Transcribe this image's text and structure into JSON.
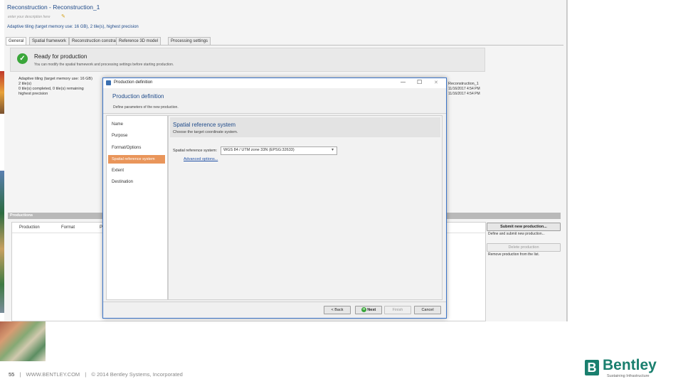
{
  "app": {
    "title": "Reconstruction - Reconstruction_1",
    "description_placeholder": "enter your description here",
    "summary": "Adaptive tiling (target memory use: 16 GB), 2 tile(s), highest precision",
    "tabs": [
      "General",
      "Spatial framework",
      "Reconstruction constraints",
      "Reference 3D model",
      "Processing settings"
    ],
    "status_title": "Ready for production",
    "status_sub": "You can modify the spatial framework and processing settings before starting production.",
    "info_lines": [
      "Adaptive tiling (target memory use: 16 GB)",
      "2 tile(s)",
      "0 tile(s) completed, 0 tile(s) remaining",
      "highest precision"
    ],
    "right_info_lines": [
      "Reconstruction_1",
      "11/16/2017 4:54 PM",
      "11/16/2017 4:54 PM"
    ],
    "productions_header": "Productions",
    "productions_columns": [
      "Production",
      "Format",
      "P"
    ],
    "submit_button": "Submit new production...",
    "submit_desc": "Define and submit new production...",
    "delete_button": "Delete production",
    "delete_desc": "Remove production from the list."
  },
  "dialog": {
    "window_title": "Production definition",
    "heading": "Production definition",
    "subheading": "Define parameters of the new production.",
    "controls": {
      "minimize": "—",
      "maximize": "☐",
      "close": "✕"
    },
    "nav": [
      "Name",
      "Purpose",
      "Format/Options",
      "Spatial reference system",
      "Extent",
      "Destination"
    ],
    "active_nav": "Spatial reference system",
    "section_title": "Spatial reference system",
    "section_sub": "Choose the target coordinate system.",
    "srs_label": "Spatial reference system:",
    "srs_value": "WGS 84 / UTM zone 33N (EPSG:32633)",
    "advanced_link": "Advanced options...",
    "buttons": {
      "back": "< Back",
      "next": "Next",
      "finish": "Finish",
      "cancel": "Cancel"
    }
  },
  "footer": {
    "page": "55",
    "sep1": "|",
    "site": "WWW.BENTLEY.COM",
    "sep2": "|",
    "copyright": "© 2014 Bentley Systems, Incorporated"
  },
  "logo": {
    "name": "Bentley",
    "tagline": "Sustaining Infrastructure",
    "color": "#1a7f6e"
  },
  "colors": {
    "active_nav": "#e9955a",
    "link": "#1f4fa5",
    "status_green": "#3aa63a",
    "dialog_border": "#3b74c8"
  }
}
